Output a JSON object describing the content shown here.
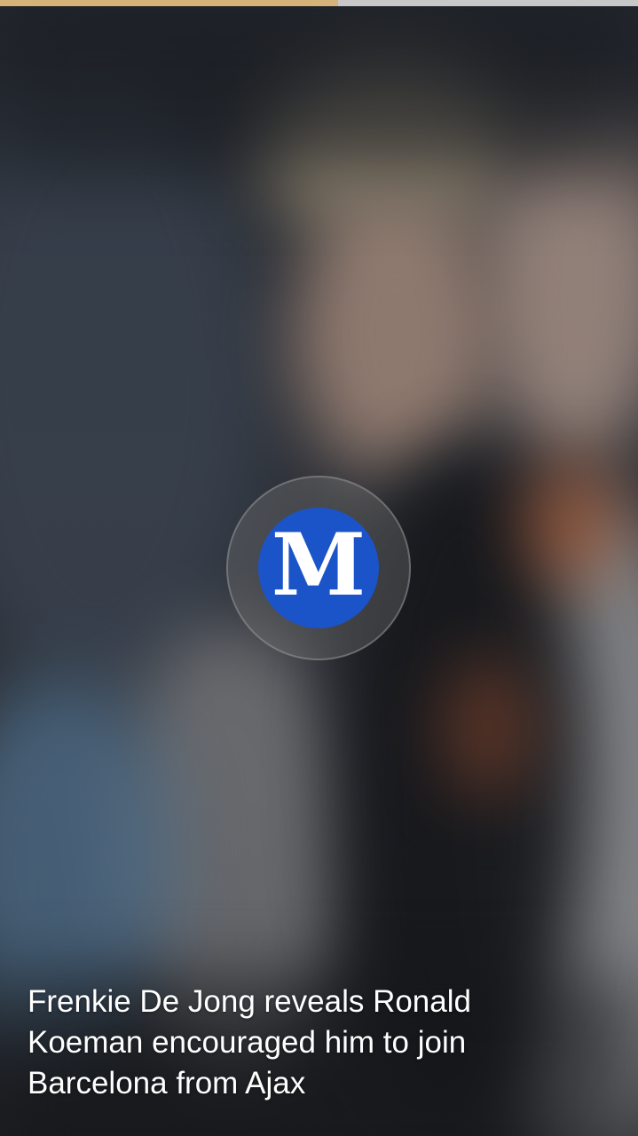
{
  "progress": {
    "fraction": 0.53,
    "fill_color": "#d4b27a",
    "track_color": "#c8c8c8"
  },
  "logo": {
    "icon": "daily-mail-m-logo",
    "glyph": "M",
    "background_color": "#1b54c9"
  },
  "story": {
    "headline": "Frenkie De Jong reveals Ronald Koeman encouraged him to join Barcelona from Ajax"
  }
}
